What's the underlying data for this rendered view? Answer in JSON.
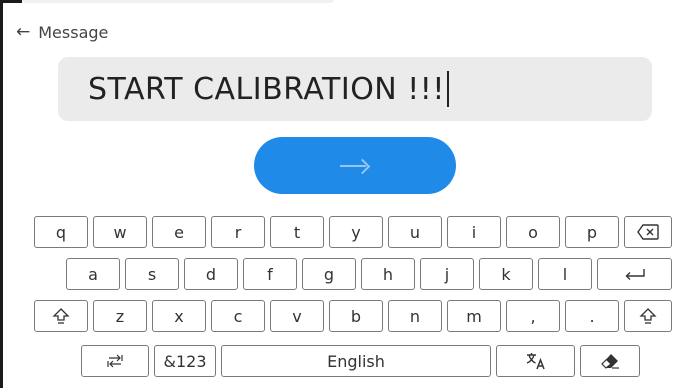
{
  "header": {
    "title": "Message"
  },
  "input": {
    "value": "START CALIBRATION !!!"
  },
  "keyboard": {
    "row1": [
      "q",
      "w",
      "e",
      "r",
      "t",
      "y",
      "u",
      "i",
      "o",
      "p"
    ],
    "row2": [
      "a",
      "s",
      "d",
      "f",
      "g",
      "h",
      "j",
      "k",
      "l"
    ],
    "row3": [
      "z",
      "x",
      "c",
      "v",
      "b",
      "n",
      "m",
      ",",
      "."
    ],
    "symbols_label": "&123",
    "space_label": "English"
  },
  "icons": {
    "back": "arrow-left-icon",
    "submit": "arrow-right-icon",
    "backspace": "backspace-icon",
    "enter": "enter-icon",
    "shift": "shift-icon",
    "switch": "keyboard-switch-icon",
    "translate": "translate-icon",
    "eraser": "eraser-icon"
  },
  "colors": {
    "accent": "#1f8ae8",
    "field_bg": "#ebebeb",
    "key_border": "#7a7a7a"
  }
}
